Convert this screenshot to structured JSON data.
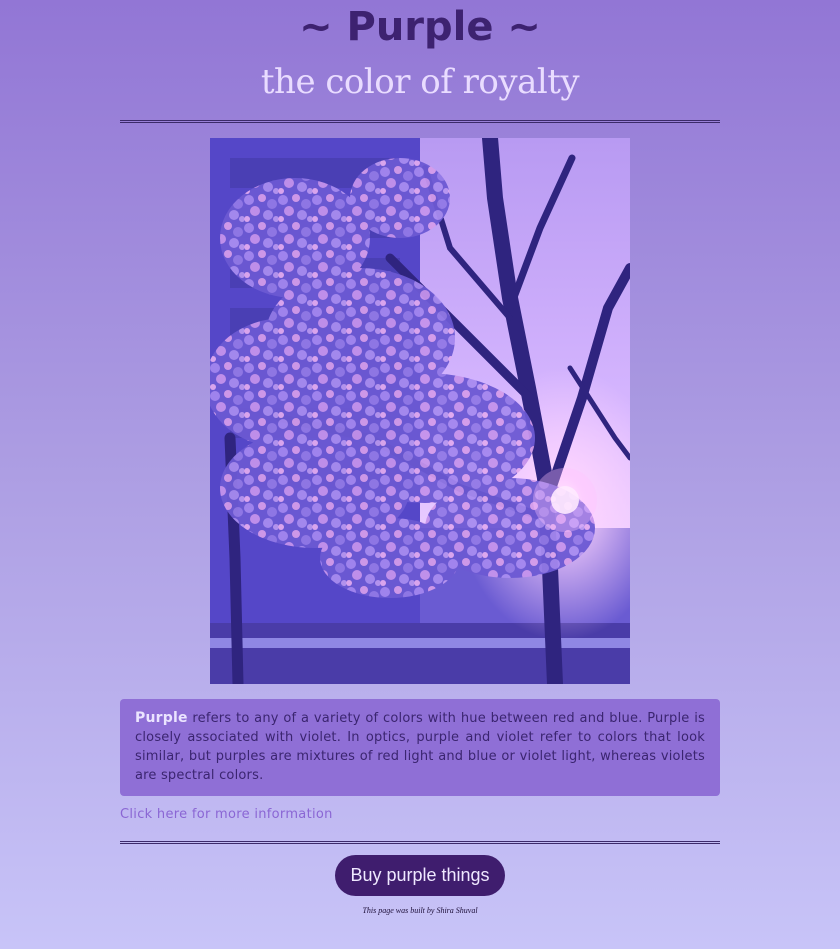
{
  "header": {
    "title": "~ Purple ~",
    "subtitle": "the color of royalty"
  },
  "description": {
    "keyword": "Purple",
    "text": " refers to any of a variety of colors with hue between red and blue. Purple is closely associated with violet. In optics, purple and violet refer to colors that look similar, but purples are mixtures of red light and blue or violet light, whereas violets are spectral colors."
  },
  "link": {
    "label": "Click here for more information"
  },
  "button": {
    "label": "Buy purple things"
  },
  "footer": {
    "credit": "This page was built by Shira Shuval"
  },
  "colors": {
    "background_top": "#9276d5",
    "background_bottom": "#c8c4f8",
    "title": "#3d2270",
    "subtitle": "#e9dcff",
    "description_box": "#8f6fd6",
    "link": "#8a66d4",
    "button": "#3f1d6e"
  }
}
